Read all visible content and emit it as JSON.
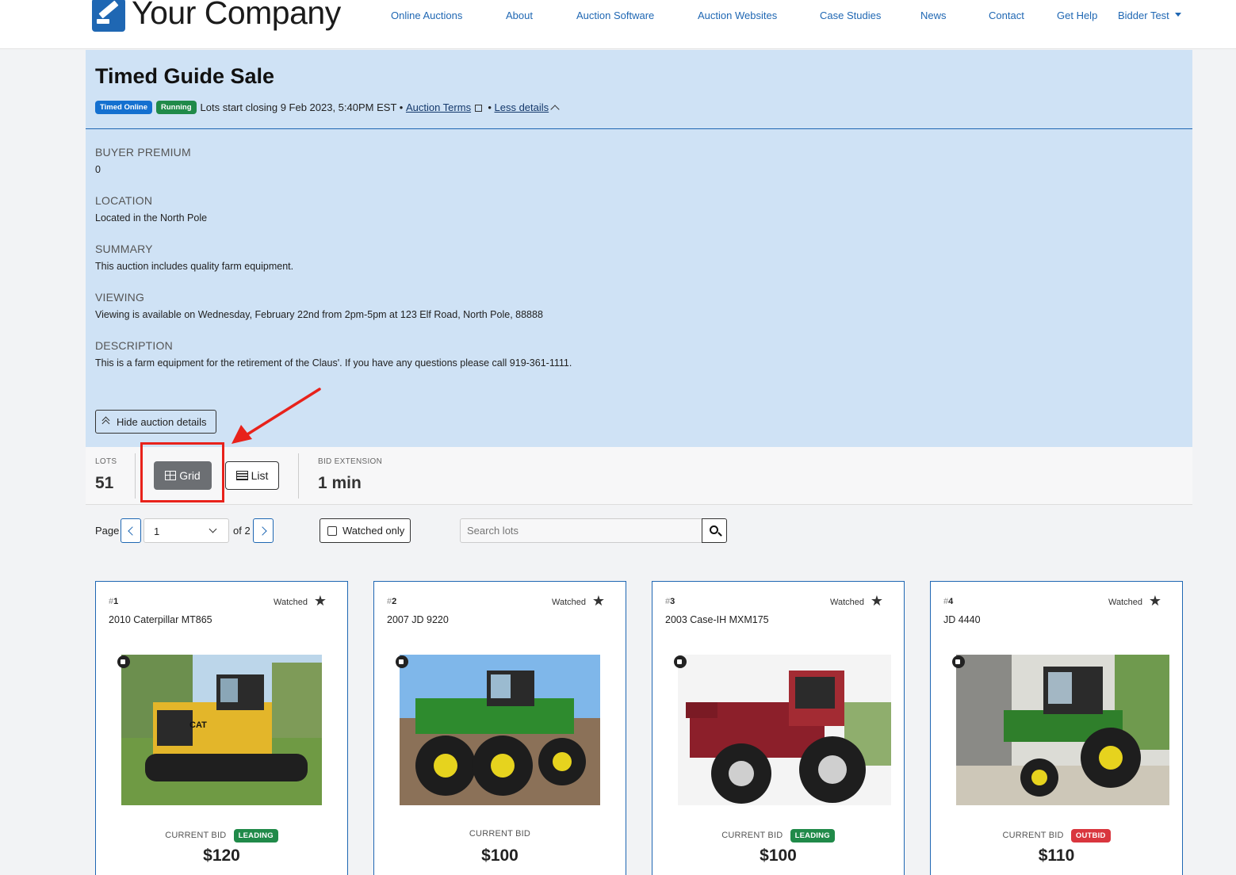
{
  "brand": {
    "name": "Your Company"
  },
  "nav": {
    "items": [
      "Online Auctions",
      "About",
      "Auction Software",
      "Auction Websites",
      "Case Studies",
      "News",
      "Contact",
      "Get Help"
    ],
    "user_menu": "Bidder Test"
  },
  "auction": {
    "title": "Timed Guide Sale",
    "badges": [
      "Timed Online",
      "Running"
    ],
    "closing_text": "Lots start closing 9 Feb 2023, 5:40PM EST •",
    "terms_link": "Auction Terms",
    "bullet": "•",
    "less_details_link": "Less details",
    "fields": [
      {
        "label": "BUYER PREMIUM",
        "value": "0"
      },
      {
        "label": "LOCATION",
        "value": "Located in the North Pole"
      },
      {
        "label": "SUMMARY",
        "value": "This auction includes quality farm equipment."
      },
      {
        "label": "VIEWING",
        "value": "Viewing is available on Wednesday, February 22nd from 2pm-5pm at 123 Elf Road, North Pole, 88888"
      },
      {
        "label": "DESCRIPTION",
        "value": "This is a farm equipment for the retirement of the Claus'. If you have any questions please call 919-361-1111."
      }
    ],
    "hide_details_button": "Hide auction details"
  },
  "stats": {
    "lots_label": "LOTS",
    "lots_value": "51",
    "grid_button": "Grid",
    "list_button": "List",
    "bid_extension_label": "BID EXTENSION",
    "bid_extension_value": "1 min"
  },
  "pager": {
    "page_label": "Page",
    "current_page": "1",
    "of_label": "of 2",
    "watched_only": "Watched only",
    "search_placeholder": "Search lots"
  },
  "lots": [
    {
      "hash": "#",
      "number": "1",
      "title": "2010 Caterpillar MT865",
      "watched_label": "Watched",
      "bid_label": "CURRENT BID",
      "status": "LEADING",
      "amount": "$120"
    },
    {
      "hash": "#",
      "number": "2",
      "title": "2007 JD 9220",
      "watched_label": "Watched",
      "bid_label": "CURRENT BID",
      "status": "",
      "amount": "$100"
    },
    {
      "hash": "#",
      "number": "3",
      "title": "2003 Case-IH MXM175",
      "watched_label": "Watched",
      "bid_label": "CURRENT BID",
      "status": "LEADING",
      "amount": "$100"
    },
    {
      "hash": "#",
      "number": "4",
      "title": "JD 4440",
      "watched_label": "Watched",
      "bid_label": "CURRENT BID",
      "status": "OUTBID",
      "amount": "$110"
    }
  ],
  "colors": {
    "primary": "#1f67b3",
    "panel_bg": "#cfe2f5",
    "leading": "#208a49",
    "outbid": "#d9363e",
    "annotation": "#e8221b"
  }
}
